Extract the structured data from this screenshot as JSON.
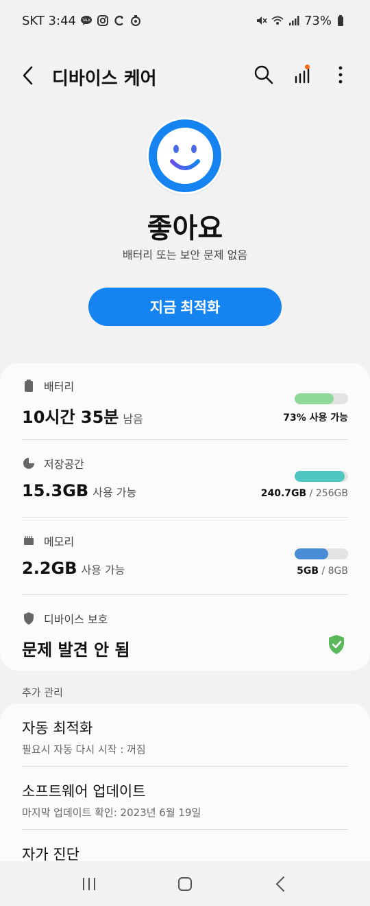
{
  "statusbar": {
    "time": "SKT 3:44",
    "battery": "73%",
    "left_icons": [
      "talk-icon",
      "instagram-icon",
      "c-icon",
      "shield-small-icon"
    ],
    "right_icons": [
      "mute-icon",
      "wifi-icon",
      "signal-icon",
      "battery-icon"
    ]
  },
  "appbar": {
    "title": "디바이스 케어"
  },
  "hero": {
    "status": "좋아요",
    "subtitle": "배터리 또는 보안 문제 없음",
    "optimize_label": "지금 최적화"
  },
  "battery": {
    "label": "배터리",
    "value": "10시간 35분",
    "unit": "남음",
    "meter_fraction": 0.73,
    "meter_color": "#8fd99a",
    "caption_bold": "73% 사용 가능"
  },
  "storage": {
    "label": "저장공간",
    "value": "15.3GB",
    "unit": "사용 가능",
    "meter_fraction": 0.94,
    "meter_color": "#4fc6c0",
    "caption_bold": "240.7GB",
    "caption_rest": " / 256GB"
  },
  "memory": {
    "label": "메모리",
    "value": "2.2GB",
    "unit": "사용 가능",
    "meter_fraction": 0.63,
    "meter_color": "#4a8cd6",
    "caption_bold": "5GB",
    "caption_rest": " / 8GB"
  },
  "protection": {
    "label": "디바이스 보호",
    "value": "문제 발견 안 됨",
    "shield_color": "#5cb85c"
  },
  "extra": {
    "heading": "추가 관리",
    "items": [
      {
        "title": "자동 최적화",
        "subtitle": "필요시 자동 다시 시작 : 꺼짐"
      },
      {
        "title": "소프트웨어 업데이트",
        "subtitle": "마지막 업데이트 확인: 2023년 6월 19일"
      },
      {
        "title": "자가 진단",
        "subtitle": ""
      }
    ]
  },
  "colors": {
    "accent": "#1584f0",
    "smiley_blue": "#1584f0",
    "smiley_purple": "#6a4de8"
  }
}
